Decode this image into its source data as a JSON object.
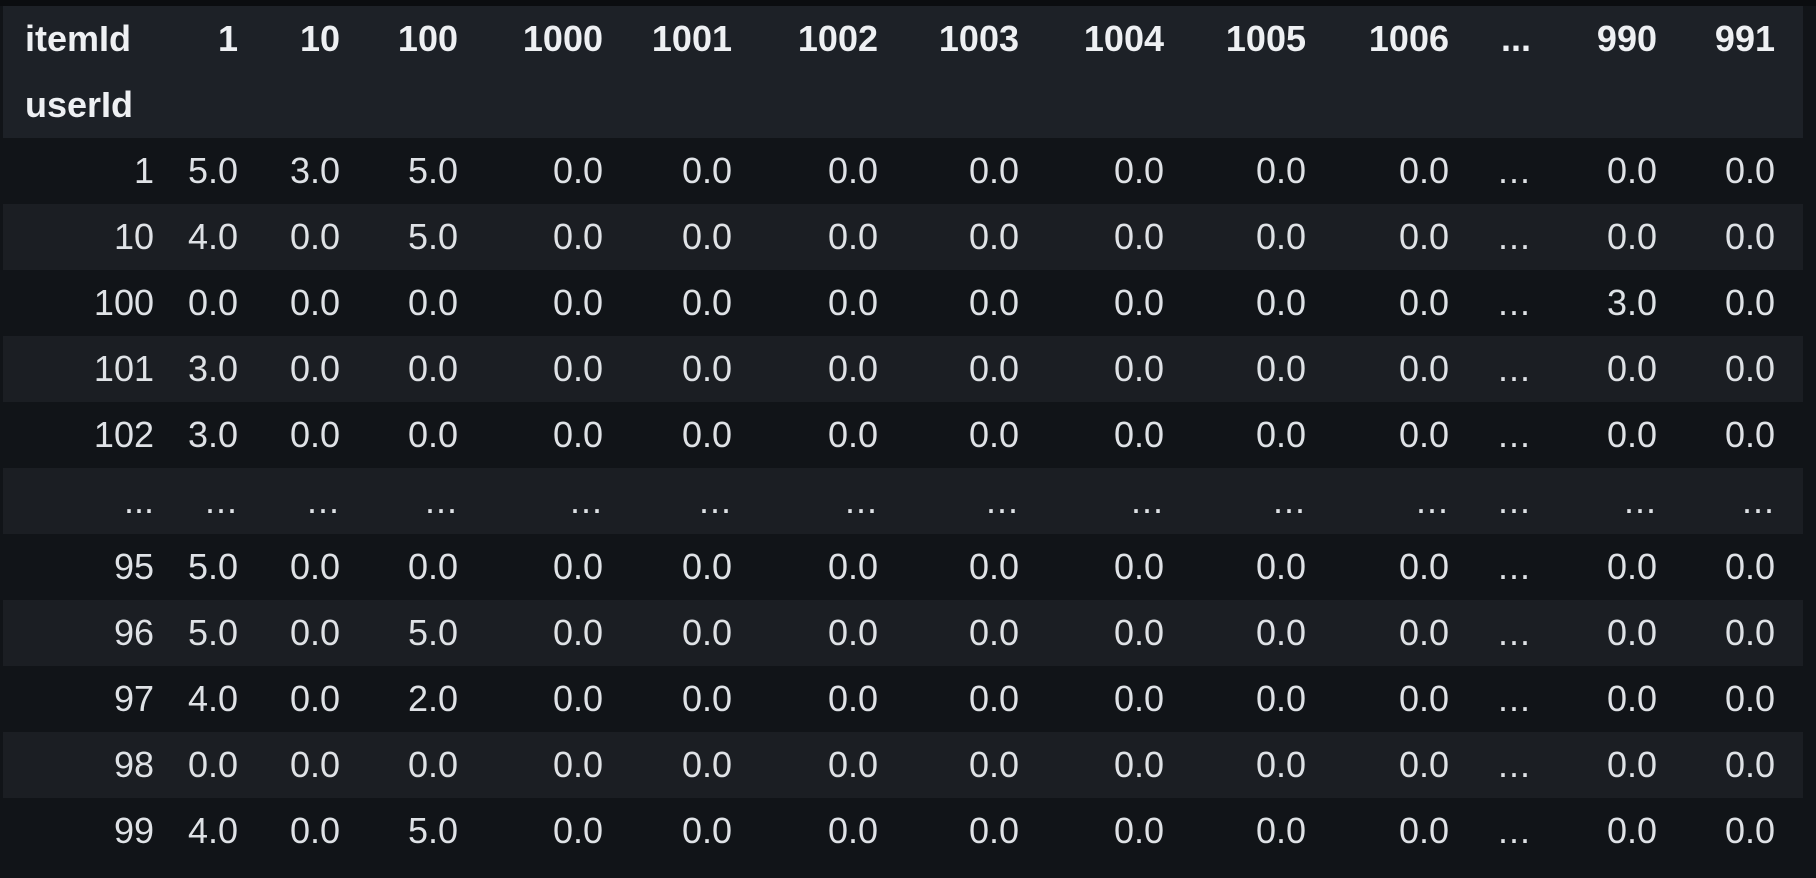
{
  "table": {
    "columns_name": "itemId",
    "index_name": "userId",
    "columns": [
      "1",
      "10",
      "100",
      "1000",
      "1001",
      "1002",
      "1003",
      "1004",
      "1005",
      "1006",
      "...",
      "990",
      "991"
    ],
    "rows": [
      {
        "index": "1",
        "values": [
          "5.0",
          "3.0",
          "5.0",
          "0.0",
          "0.0",
          "0.0",
          "0.0",
          "0.0",
          "0.0",
          "0.0",
          "...",
          "0.0",
          "0.0"
        ]
      },
      {
        "index": "10",
        "values": [
          "4.0",
          "0.0",
          "5.0",
          "0.0",
          "0.0",
          "0.0",
          "0.0",
          "0.0",
          "0.0",
          "0.0",
          "...",
          "0.0",
          "0.0"
        ]
      },
      {
        "index": "100",
        "values": [
          "0.0",
          "0.0",
          "0.0",
          "0.0",
          "0.0",
          "0.0",
          "0.0",
          "0.0",
          "0.0",
          "0.0",
          "...",
          "3.0",
          "0.0"
        ]
      },
      {
        "index": "101",
        "values": [
          "3.0",
          "0.0",
          "0.0",
          "0.0",
          "0.0",
          "0.0",
          "0.0",
          "0.0",
          "0.0",
          "0.0",
          "...",
          "0.0",
          "0.0"
        ]
      },
      {
        "index": "102",
        "values": [
          "3.0",
          "0.0",
          "0.0",
          "0.0",
          "0.0",
          "0.0",
          "0.0",
          "0.0",
          "0.0",
          "0.0",
          "...",
          "0.0",
          "0.0"
        ]
      },
      {
        "index": "...",
        "values": [
          "...",
          "...",
          "...",
          "...",
          "...",
          "...",
          "...",
          "...",
          "...",
          "...",
          "...",
          "...",
          "..."
        ]
      },
      {
        "index": "95",
        "values": [
          "5.0",
          "0.0",
          "0.0",
          "0.0",
          "0.0",
          "0.0",
          "0.0",
          "0.0",
          "0.0",
          "0.0",
          "...",
          "0.0",
          "0.0"
        ]
      },
      {
        "index": "96",
        "values": [
          "5.0",
          "0.0",
          "5.0",
          "0.0",
          "0.0",
          "0.0",
          "0.0",
          "0.0",
          "0.0",
          "0.0",
          "...",
          "0.0",
          "0.0"
        ]
      },
      {
        "index": "97",
        "values": [
          "4.0",
          "0.0",
          "2.0",
          "0.0",
          "0.0",
          "0.0",
          "0.0",
          "0.0",
          "0.0",
          "0.0",
          "...",
          "0.0",
          "0.0"
        ]
      },
      {
        "index": "98",
        "values": [
          "0.0",
          "0.0",
          "0.0",
          "0.0",
          "0.0",
          "0.0",
          "0.0",
          "0.0",
          "0.0",
          "0.0",
          "...",
          "0.0",
          "0.0"
        ]
      },
      {
        "index": "99",
        "values": [
          "4.0",
          "0.0",
          "5.0",
          "0.0",
          "0.0",
          "0.0",
          "0.0",
          "0.0",
          "0.0",
          "0.0",
          "...",
          "0.0",
          "0.0"
        ]
      }
    ]
  },
  "colors": {
    "background": "#111418",
    "header_background": "#1d2127",
    "stripe_background": "#1b1e23",
    "text": "#dfe2e6"
  }
}
